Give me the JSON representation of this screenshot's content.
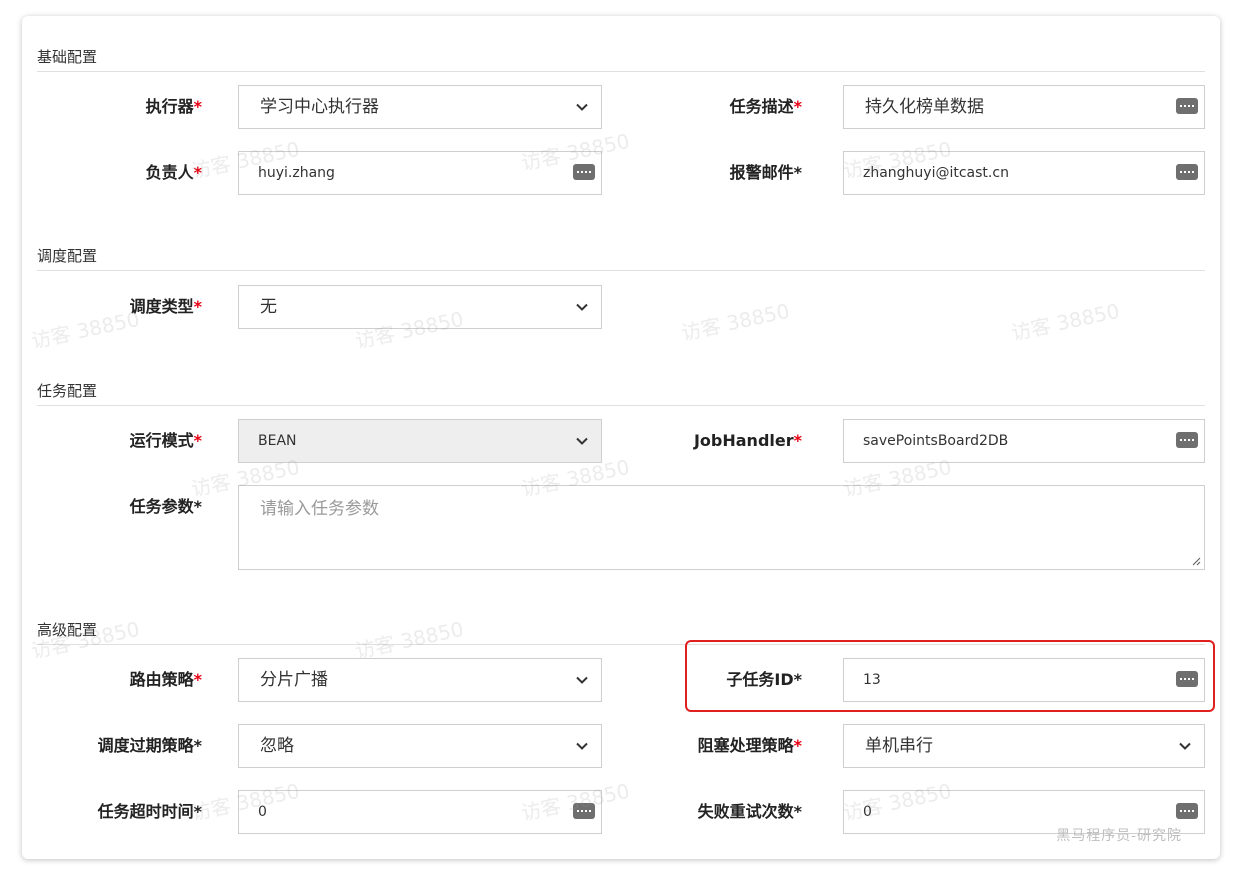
{
  "sections": {
    "basic": "基础配置",
    "schedule": "调度配置",
    "task": "任务配置",
    "advanced": "高级配置"
  },
  "fields": {
    "executor": {
      "label": "执行器",
      "value": "学习中心执行器"
    },
    "task_desc": {
      "label": "任务描述",
      "value": "持久化榜单数据"
    },
    "owner": {
      "label": "负责人",
      "value": "huyi.zhang"
    },
    "alarm_email": {
      "label": "报警邮件",
      "value": "zhanghuyi@itcast.cn"
    },
    "schedule_type": {
      "label": "调度类型",
      "value": "无"
    },
    "run_mode": {
      "label": "运行模式",
      "value": "BEAN"
    },
    "job_handler": {
      "label": "JobHandler",
      "value": "savePointsBoard2DB"
    },
    "task_params": {
      "label": "任务参数",
      "placeholder": "请输入任务参数"
    },
    "route_strategy": {
      "label": "路由策略",
      "value": "分片广播"
    },
    "child_job_id": {
      "label": "子任务ID",
      "value": "13"
    },
    "misfire_strategy": {
      "label": "调度过期策略",
      "value": "忽略"
    },
    "block_strategy": {
      "label": "阻塞处理策略",
      "value": "单机串行"
    },
    "timeout": {
      "label": "任务超时时间",
      "value": "0"
    },
    "retry_count": {
      "label": "失败重试次数",
      "value": "0"
    }
  },
  "required_mark": "*",
  "watermark_text": "访客 38850",
  "site_mark": "黑马程序员-研究院",
  "colors": {
    "required": "#e60012",
    "highlight": "#e0201f"
  }
}
